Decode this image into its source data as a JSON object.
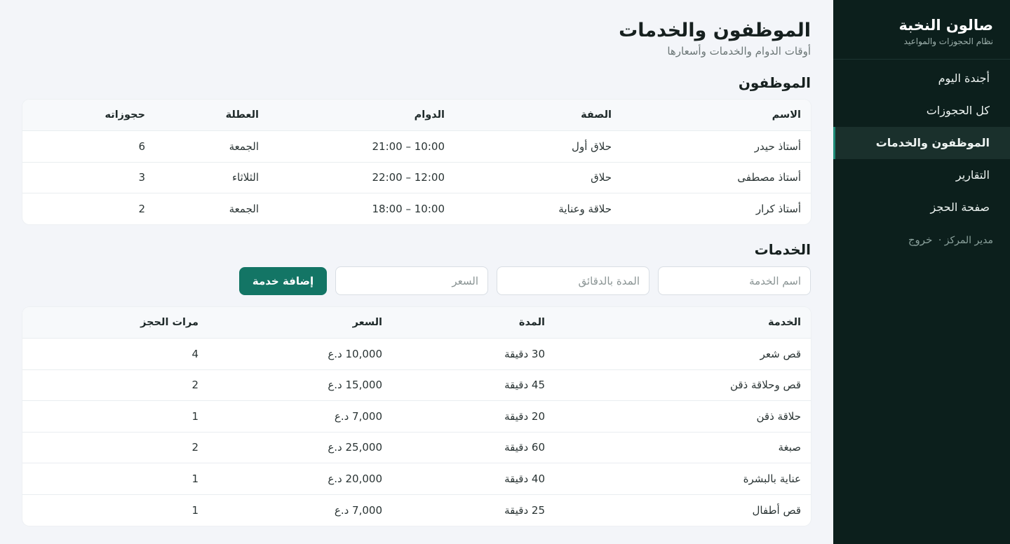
{
  "sidebar": {
    "brand_title": "صالون النخبة",
    "brand_subtitle": "نظام الحجوزات والمواعيد",
    "nav": [
      {
        "label": "أجندة اليوم"
      },
      {
        "label": "كل الحجوزات"
      },
      {
        "label": "الموظفون والخدمات",
        "active": true
      },
      {
        "label": "التقارير"
      },
      {
        "label": "صفحة الحجز"
      }
    ],
    "footer_user": "مدير المركز ·",
    "logout_label": "خروج"
  },
  "header": {
    "title": "الموظفون والخدمات",
    "subtitle": "أوقات الدوام والخدمات وأسعارها"
  },
  "staff": {
    "section_title": "الموظفون",
    "columns": [
      "الاسم",
      "الصفة",
      "الدوام",
      "العطلة",
      "حجوزاته"
    ],
    "rows": [
      [
        "أستاذ حيدر",
        "حلاق أول",
        "10:00 – 21:00",
        "الجمعة",
        "6"
      ],
      [
        "أستاذ مصطفى",
        "حلاق",
        "12:00 – 22:00",
        "الثلاثاء",
        "3"
      ],
      [
        "أستاذ كرار",
        "حلاقة وعناية",
        "10:00 – 18:00",
        "الجمعة",
        "2"
      ]
    ]
  },
  "services": {
    "section_title": "الخدمات",
    "form": {
      "name_placeholder": "اسم الخدمة",
      "duration_placeholder": "المدة بالدقائق",
      "price_placeholder": "السعر",
      "add_label": "إضافة خدمة"
    },
    "columns": [
      "الخدمة",
      "المدة",
      "السعر",
      "مرات الحجز"
    ],
    "rows": [
      [
        "قص شعر",
        "30 دقيقة",
        "10,000 د.ع",
        "4"
      ],
      [
        "قص وحلاقة ذقن",
        "45 دقيقة",
        "15,000 د.ع",
        "2"
      ],
      [
        "حلاقة ذقن",
        "20 دقيقة",
        "7,000 د.ع",
        "1"
      ],
      [
        "صبغة",
        "60 دقيقة",
        "25,000 د.ع",
        "2"
      ],
      [
        "عناية بالبشرة",
        "40 دقيقة",
        "20,000 د.ع",
        "1"
      ],
      [
        "قص أطفال",
        "25 دقيقة",
        "7,000 د.ع",
        "1"
      ]
    ]
  },
  "colors": {
    "sidebar_bg": "#0c1f1c",
    "accent": "#137565",
    "page_bg": "#f3f5f9"
  }
}
